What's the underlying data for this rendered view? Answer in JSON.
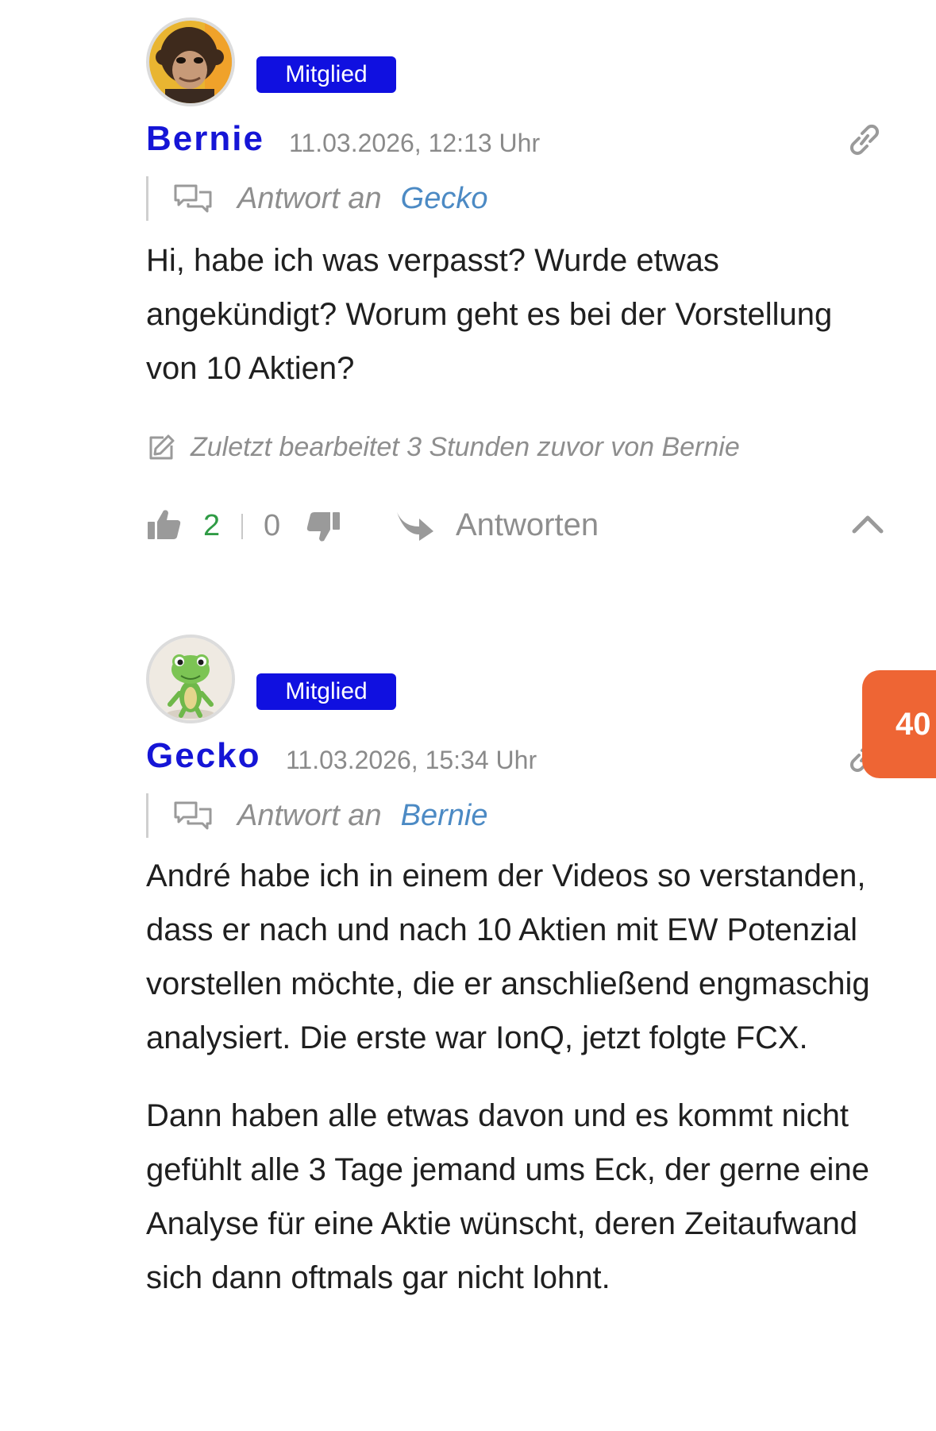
{
  "comments": [
    {
      "author": "Bernie",
      "role_badge": "Mitglied",
      "date": "11.03.2026, 12:13 Uhr",
      "reply_prefix": "Antwort an",
      "reply_to": "Gecko",
      "paragraphs": [
        "Hi, habe ich was verpasst? Wurde etwas angekündigt? Worum geht es bei der Vorstellung von 10 Aktien?"
      ],
      "edited_note": "Zuletzt bearbeitet 3 Stunden zuvor von Bernie",
      "likes": "2",
      "dislikes": "0",
      "reply_label": "Antworten"
    },
    {
      "author": "Gecko",
      "role_badge": "Mitglied",
      "date": "11.03.2026, 15:34 Uhr",
      "reply_prefix": "Antwort an",
      "reply_to": "Bernie",
      "paragraphs": [
        "André habe ich in einem der Videos so verstanden, dass er nach und nach 10 Aktien mit EW Potenzial vorstellen möchte, die er anschließend engmaschig analysiert. Die erste war IonQ, jetzt folgte FCX.",
        "Dann haben alle etwas davon und es kommt nicht gefühlt alle 3 Tage jemand ums Eck, der gerne eine Analyse für eine Aktie wünscht, deren Zeitaufwand sich dann oftmals gar nicht lohnt."
      ]
    }
  ],
  "floating_badge": "40",
  "icons": {
    "permalink": "link-icon",
    "reply_to": "chat-bubbles-icon",
    "edited": "edit-icon",
    "like": "thumbs-up-icon",
    "dislike": "thumbs-down-icon",
    "reply": "reply-arrow-icon",
    "collapse": "chevron-up-icon"
  },
  "colors": {
    "badge": "#1010e0",
    "author": "#1515d6",
    "reply_link": "#4c8ac4",
    "likes": "#2f9b45",
    "floating_badge": "#ee6534"
  }
}
